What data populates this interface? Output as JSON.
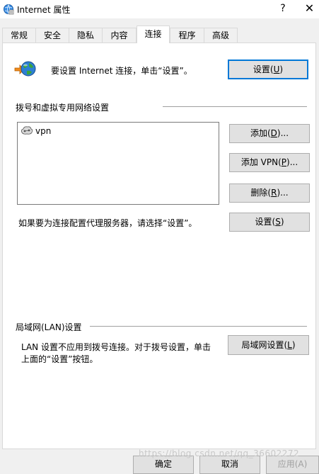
{
  "window": {
    "title": "Internet 属性",
    "help_glyph": "?",
    "close_glyph": "✕"
  },
  "tabs": [
    {
      "label": "常规"
    },
    {
      "label": "安全"
    },
    {
      "label": "隐私"
    },
    {
      "label": "内容"
    },
    {
      "label": "连接",
      "active": true
    },
    {
      "label": "程序"
    },
    {
      "label": "高级"
    }
  ],
  "setup": {
    "text": "要设置 Internet 连接，单击“设置”。",
    "button_pre": "设置(",
    "button_key": "U",
    "button_post": ")"
  },
  "dialup": {
    "section_title": "拨号和虚拟专用网络设置",
    "connections": [
      {
        "name": "vpn",
        "icon": "network-connection-icon"
      }
    ],
    "add_button": {
      "pre": "添加(",
      "key": "D",
      "post": ")..."
    },
    "add_vpn_button": {
      "pre": "添加 VPN(",
      "key": "P",
      "post": ")..."
    },
    "remove_button": {
      "pre": "删除(",
      "key": "R",
      "post": ")..."
    },
    "proxy_text": "如果要为连接配置代理服务器，请选择“设置”。",
    "settings_button": {
      "pre": "设置(",
      "key": "S",
      "post": ")"
    }
  },
  "lan": {
    "section_title": "局域网(LAN)设置",
    "text_line1": "LAN 设置不应用到拨号连接。对于拨号设置，单击",
    "text_line2": "上面的“设置”按钮。",
    "button": {
      "pre": "局域网设置(",
      "key": "L",
      "post": ")"
    }
  },
  "footer": {
    "ok_label": "确定",
    "cancel_label": "取消",
    "apply_label": "应用(A)",
    "watermark": "https://blog.csdn.net/qq_36602272"
  },
  "colors": {
    "accent": "#0078d7",
    "panel_bg": "#ffffff",
    "window_bg": "#f0f0f0"
  }
}
